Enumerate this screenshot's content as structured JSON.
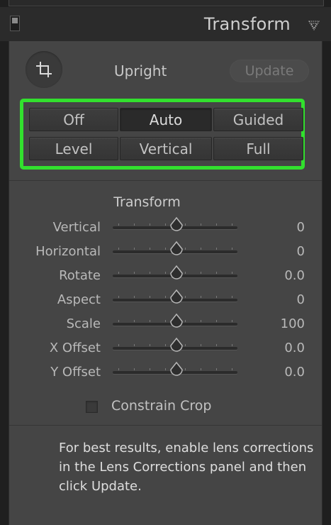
{
  "header": {
    "title": "Transform"
  },
  "upright": {
    "label": "Upright",
    "update_label": "Update",
    "modes": [
      {
        "label": "Off",
        "active": false
      },
      {
        "label": "Auto",
        "active": true
      },
      {
        "label": "Guided",
        "active": false
      },
      {
        "label": "Level",
        "active": false
      },
      {
        "label": "Vertical",
        "active": false
      },
      {
        "label": "Full",
        "active": false
      }
    ]
  },
  "transform": {
    "title": "Transform",
    "sliders": [
      {
        "label": "Vertical",
        "value": "0",
        "position": 0.5
      },
      {
        "label": "Horizontal",
        "value": "0",
        "position": 0.5
      },
      {
        "label": "Rotate",
        "value": "0.0",
        "position": 0.5
      },
      {
        "label": "Aspect",
        "value": "0",
        "position": 0.5
      },
      {
        "label": "Scale",
        "value": "100",
        "position": 0.5
      },
      {
        "label": "X Offset",
        "value": "0.0",
        "position": 0.5
      },
      {
        "label": "Y Offset",
        "value": "0.0",
        "position": 0.5
      }
    ],
    "constrain_crop_label": "Constrain Crop",
    "constrain_crop_checked": false
  },
  "help_text": "For best results, enable lens corrections in the Lens Corrections panel and then click Update.",
  "colors": {
    "highlight": "#32e02e",
    "panel": "#454545",
    "header": "#2b2b2b"
  },
  "icons": {
    "crop": "crop-overlay-icon",
    "collapse": "collapse-triangle-icon",
    "panel_switch": "panel-toggle-icon"
  }
}
